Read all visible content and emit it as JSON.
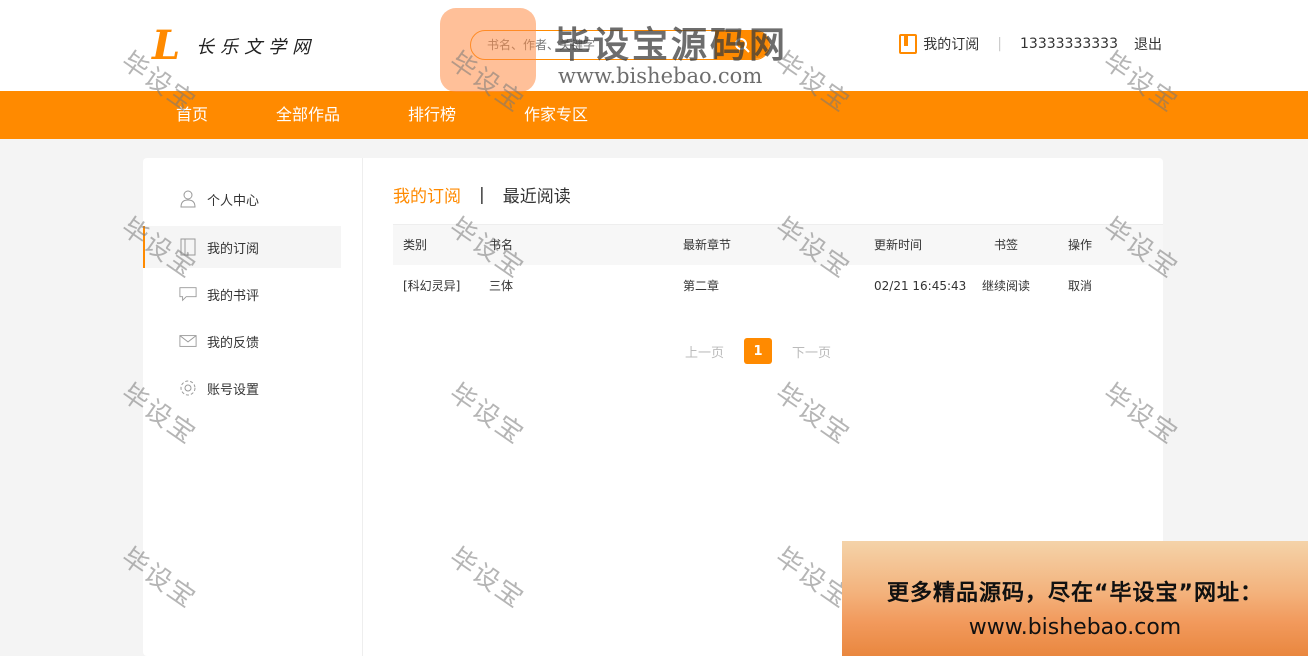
{
  "header": {
    "logo_mark": "L",
    "logo_text": "长乐文学网",
    "search_placeholder": "书名、作者、关键字",
    "subscribe_label": "我的订阅",
    "separator": "|",
    "phone": "13333333333",
    "logout_label": "退出"
  },
  "nav": {
    "items": [
      "首页",
      "全部作品",
      "排行榜",
      "作家专区"
    ]
  },
  "sidebar": {
    "items": [
      {
        "label": "个人中心",
        "icon": "user-icon"
      },
      {
        "label": "我的订阅",
        "icon": "book-icon"
      },
      {
        "label": "我的书评",
        "icon": "comment-icon"
      },
      {
        "label": "我的反馈",
        "icon": "mail-icon"
      },
      {
        "label": "账号设置",
        "icon": "gear-icon"
      }
    ]
  },
  "tabs": {
    "active": "我的订阅",
    "separator": "|",
    "other": "最近阅读"
  },
  "table": {
    "headers": [
      "类别",
      "书名",
      "最新章节",
      "更新时间",
      "书签",
      "操作"
    ],
    "rows": [
      {
        "category": "[科幻灵异]",
        "title": "三体",
        "latest_chapter": "第二章",
        "update_time": "02/21 16:45:43",
        "bookmark": "继续阅读",
        "action": "取消"
      }
    ]
  },
  "pager": {
    "prev": "上一页",
    "current": "1",
    "next": "下一页"
  },
  "watermark": {
    "text": "毕设宝",
    "brand_title": "毕设宝源码网",
    "brand_url": "www.bishebao.com",
    "promo_line1": "更多精品源码，尽在“毕设宝”网址：",
    "promo_line2": "www.bishebao.com"
  },
  "colors": {
    "accent": "#ff8a00",
    "background": "#f4f4f4"
  }
}
